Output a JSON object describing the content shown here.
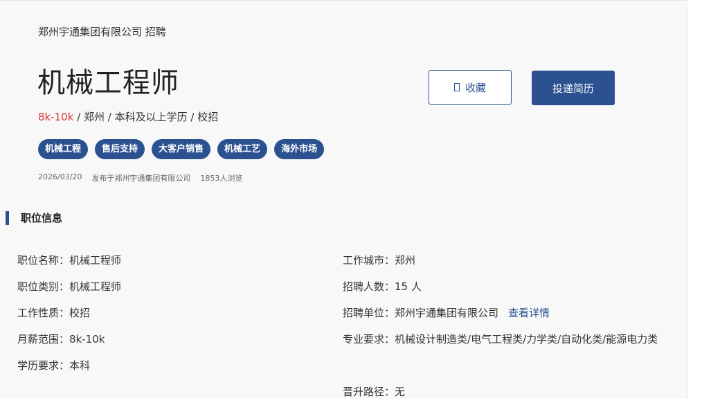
{
  "header": {
    "company_line": "郑州宇通集团有限公司 招聘",
    "job_title": "机械工程师",
    "salary": "8k-10k",
    "meta_rest": " / 郑州 / 本科及以上学历 / 校招",
    "tags": [
      "机械工程",
      "售后支持",
      "大客户销售",
      "机械工艺",
      "海外市场"
    ],
    "date": "2026/03/20",
    "published_by": "发布于郑州宇通集团有限公司",
    "views": "1853人浏览"
  },
  "actions": {
    "favorite_label": "收藏",
    "apply_label": "投递简历"
  },
  "section": {
    "title": "职位信息"
  },
  "info_left": [
    {
      "label": "职位名称：",
      "value": "机械工程师"
    },
    {
      "label": "职位类别：",
      "value": "机械工程师"
    },
    {
      "label": "工作性质：",
      "value": "校招"
    },
    {
      "label": "月薪范围：",
      "value": "8k-10k"
    },
    {
      "label": "学历要求：",
      "value": "本科"
    }
  ],
  "info_right": [
    {
      "label": "工作城市：",
      "value": "郑州"
    },
    {
      "label": "招聘人数：",
      "value": "15 人"
    },
    {
      "label": "招聘单位：",
      "value": "郑州宇通集团有限公司",
      "link": "查看详情"
    },
    {
      "label": "专业要求：",
      "value": "机械设计制造类/电气工程类/力学类/自动化类/能源电力类"
    },
    {
      "label": "晋升路径：",
      "value": "无"
    }
  ],
  "colors": {
    "primary": "#2b5191",
    "salary": "#d6372e"
  }
}
